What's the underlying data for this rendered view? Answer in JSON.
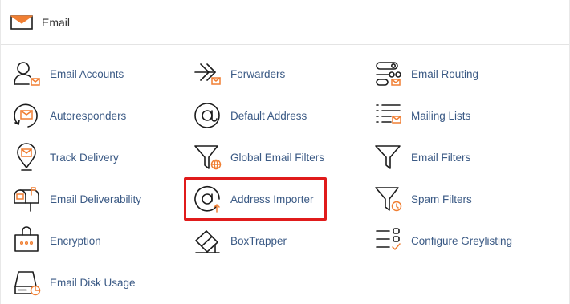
{
  "section": {
    "title": "Email",
    "icon": "envelope-icon"
  },
  "accent_color": "#f07f33",
  "link_color": "#3b5a85",
  "highlight_color": "#e01b1b",
  "highlighted_item": "Address Importer",
  "items": {
    "email_accounts": {
      "label": "Email Accounts",
      "icon": "user-envelope-icon"
    },
    "forwarders": {
      "label": "Forwarders",
      "icon": "forward-arrows-icon"
    },
    "email_routing": {
      "label": "Email Routing",
      "icon": "routing-icon"
    },
    "autoresponders": {
      "label": "Autoresponders",
      "icon": "autoresponder-icon"
    },
    "default_address": {
      "label": "Default Address",
      "icon": "at-sign-icon"
    },
    "mailing_lists": {
      "label": "Mailing Lists",
      "icon": "list-envelope-icon"
    },
    "track_delivery": {
      "label": "Track Delivery",
      "icon": "map-pin-envelope-icon"
    },
    "global_email_filters": {
      "label": "Global Email Filters",
      "icon": "funnel-globe-icon"
    },
    "email_filters": {
      "label": "Email Filters",
      "icon": "funnel-icon"
    },
    "email_deliverability": {
      "label": "Email Deliverability",
      "icon": "mailbox-icon"
    },
    "address_importer": {
      "label": "Address Importer",
      "icon": "at-upload-icon"
    },
    "spam_filters": {
      "label": "Spam Filters",
      "icon": "funnel-warning-icon"
    },
    "encryption": {
      "label": "Encryption",
      "icon": "key-card-icon"
    },
    "boxtrapper": {
      "label": "BoxTrapper",
      "icon": "trap-icon"
    },
    "configure_greylisting": {
      "label": "Configure Greylisting",
      "icon": "checklist-icon"
    },
    "email_disk_usage": {
      "label": "Email Disk Usage",
      "icon": "disk-usage-icon"
    }
  }
}
